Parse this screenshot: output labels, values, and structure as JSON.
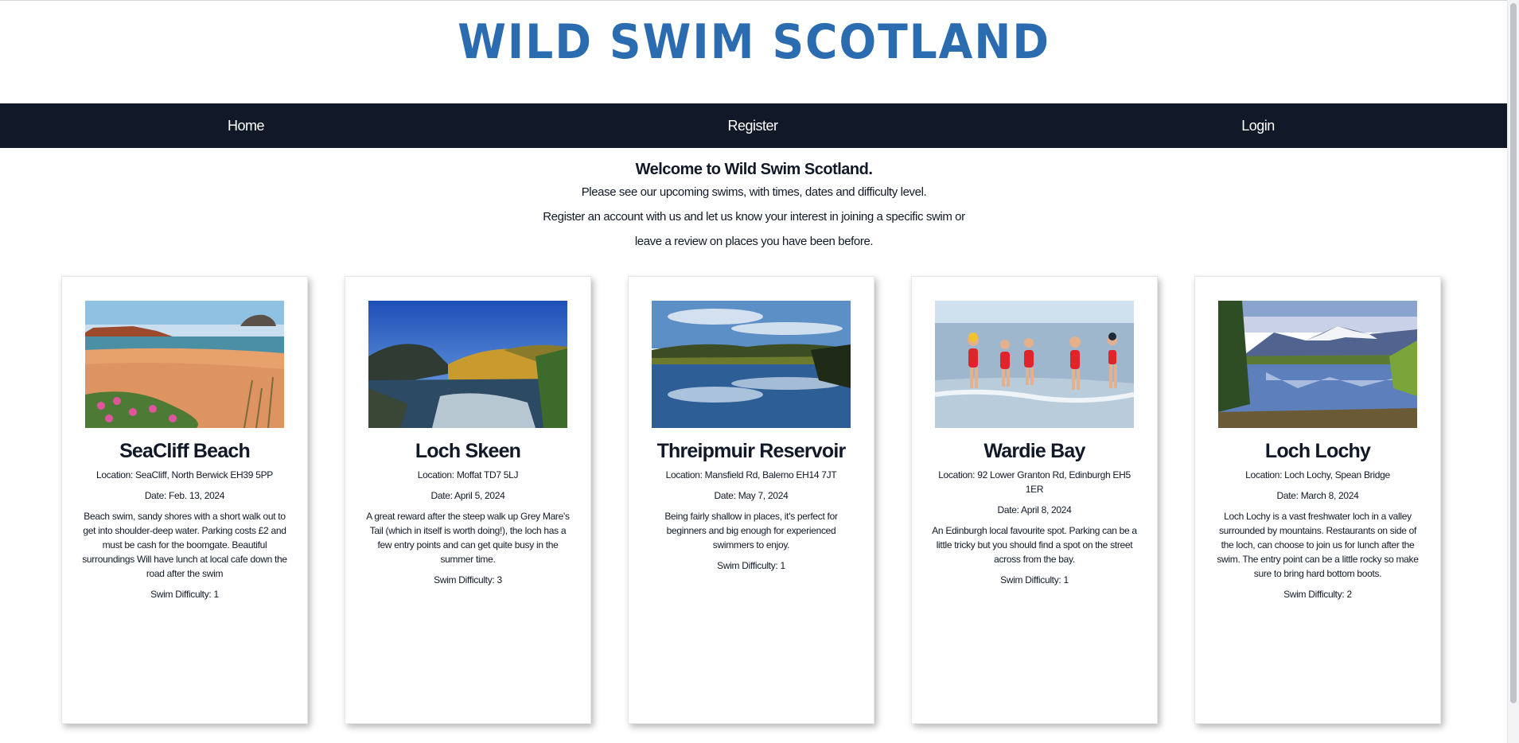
{
  "site": {
    "logo_text": "WILD SWIM SCOTLAND",
    "brand_color": "#2b6cb0",
    "nav_bg": "#111827"
  },
  "nav": {
    "items": [
      {
        "label": "Home"
      },
      {
        "label": "Register"
      },
      {
        "label": "Login"
      }
    ]
  },
  "welcome": {
    "title": "Welcome to Wild Swim Scotland.",
    "line1": "Please see our upcoming swims, with times, dates and difficulty level.",
    "line2": "Register an account with us and let us know your interest in joining a specific swim or",
    "line3": "leave a review on places you have been before."
  },
  "swims": [
    {
      "name": "SeaCliff Beach",
      "location": "Location: SeaCliff, North Berwick EH39 5PP",
      "date": "Date: Feb. 13, 2024",
      "description": "Beach swim, sandy shores with a short walk out to get into shoulder-deep water. Parking costs £2 and must be cash for the boomgate. Beautiful surroundings Will have lunch at local cafe down the road after the swim",
      "difficulty": "Swim Difficulty: 1",
      "photo_icon": "beach-photo"
    },
    {
      "name": "Loch Skeen",
      "location": "Location: Moffat TD7 5LJ",
      "date": "Date: April 5, 2024",
      "description": "A great reward after the steep walk up Grey Mare's Tail (which in itself is worth doing!), the loch has a few entry points and can get quite busy in the summer time.",
      "difficulty": "Swim Difficulty: 3",
      "photo_icon": "loch-hills-photo"
    },
    {
      "name": "Threipmuir Reservoir",
      "location": "Location: Mansfield Rd, Balerno EH14 7JT",
      "date": "Date: May 7, 2024",
      "description": "Being fairly shallow in places, it's perfect for beginners and big enough for experienced swimmers to enjoy.",
      "difficulty": "Swim Difficulty: 1",
      "photo_icon": "reservoir-photo"
    },
    {
      "name": "Wardie Bay",
      "location": "Location: 92 Lower Granton Rd, Edinburgh EH5 1ER",
      "date": "Date: April 8, 2024",
      "description": "An Edinburgh local favourite spot. Parking can be a little tricky but you should find a spot on the street across from the bay.",
      "difficulty": "Swim Difficulty: 1",
      "photo_icon": "swimmers-photo"
    },
    {
      "name": "Loch Lochy",
      "location": "Location: Loch Lochy, Spean Bridge",
      "date": "Date: March 8, 2024",
      "description": "Loch Lochy is a vast freshwater loch in a valley surrounded by mountains. Restaurants on side of the loch, can choose to join us for lunch after the swim. The entry point can be a little rocky so make sure to bring hard bottom boots.",
      "difficulty": "Swim Difficulty: 2",
      "photo_icon": "mountain-loch-photo"
    }
  ]
}
